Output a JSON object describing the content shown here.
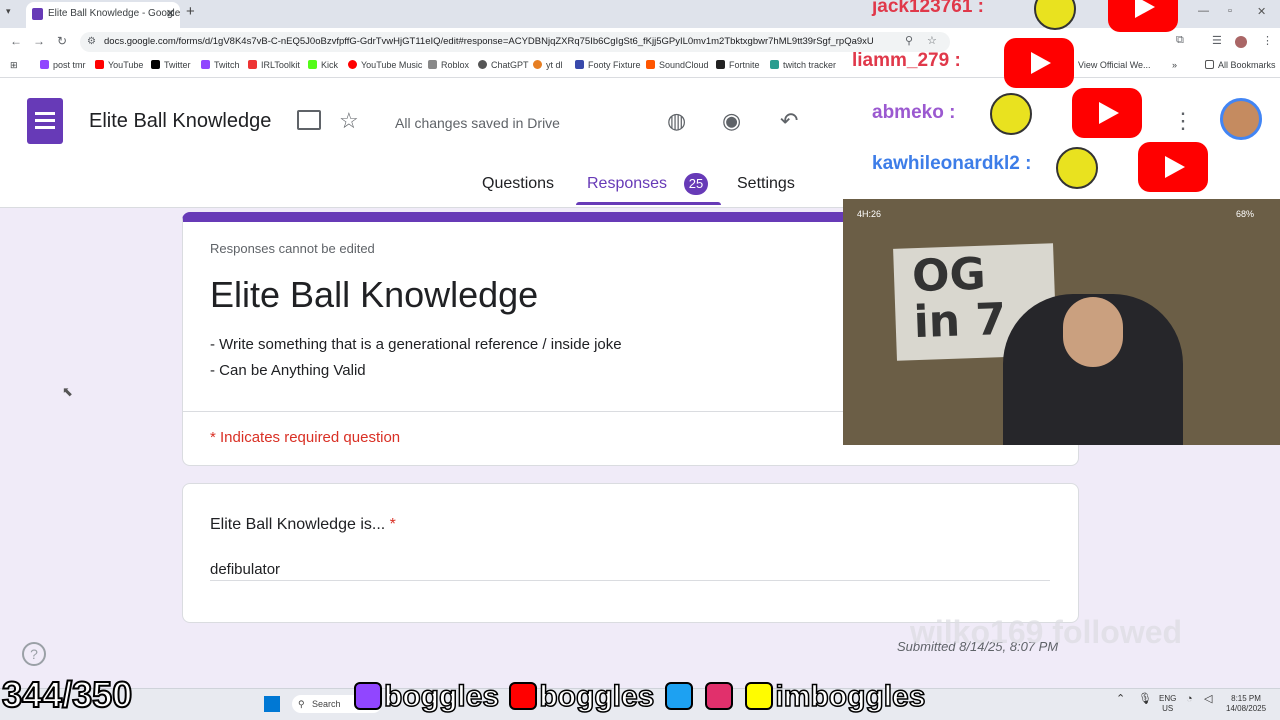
{
  "browser": {
    "tab_title": "Elite Ball Knowledge - Google F",
    "url": "docs.google.com/forms/d/1gV8K4s7vB-C-nEQ5J0oBzvfpffG-GdrTvwHjGT11eIQ/edit#response=ACYDBNjqZXRq75Ib6CgIgSt6_fKjj5GPyIL0mv1m2Tbktxgbwr7hML9tt39rSgf_rpQa9xU",
    "bookmarks": [
      "post tmr",
      "YouTube",
      "Twitter",
      "Twitch",
      "IRLToolkit",
      "Kick",
      "YouTube Music",
      "Roblox",
      "ChatGPT",
      "yt dl",
      "Footy Fixture",
      "SoundCloud",
      "Fortnite",
      "twitch tracker"
    ],
    "bookmarks_more": "View Official We...",
    "all_bookmarks": "All Bookmarks"
  },
  "header": {
    "title": "Elite Ball Knowledge",
    "saved_status": "All changes saved in Drive",
    "tabs": {
      "questions": "Questions",
      "responses": "Responses",
      "settings": "Settings"
    },
    "responses_count": "25"
  },
  "form": {
    "note": "Responses cannot be edited",
    "title": "Elite Ball Knowledge",
    "description": [
      "- Write something that is a generational reference / inside joke",
      "- Can be Anything Valid"
    ],
    "required_note": "* Indicates required question",
    "question": "Elite Ball Knowledge is...",
    "required_star": "*",
    "answer": "defibulator",
    "submitted": "Submitted 8/14/25, 8:07 PM"
  },
  "overlay": {
    "chat": [
      {
        "user": "jack123761 :",
        "color": "#e0384a"
      },
      {
        "user": "liamm_279 :",
        "color": "#e0384a"
      },
      {
        "user": "abmeko :",
        "color": "#9b59d0"
      },
      {
        "user": "kawhileonardkl2 :",
        "color": "#3d7de8"
      }
    ],
    "webcam_time": "4H:26",
    "webcam_battery": "68%",
    "followed": "wilko169 followed",
    "goal_counter": "344/350",
    "socials": [
      "boggles",
      "boggles",
      "imboggles"
    ]
  },
  "taskbar": {
    "search": "Search",
    "lang": "ENG",
    "region": "US",
    "time": "8:15 PM",
    "date": "14/08/2025"
  },
  "colors": {
    "accent": "#673ab7",
    "required": "#d93025"
  }
}
